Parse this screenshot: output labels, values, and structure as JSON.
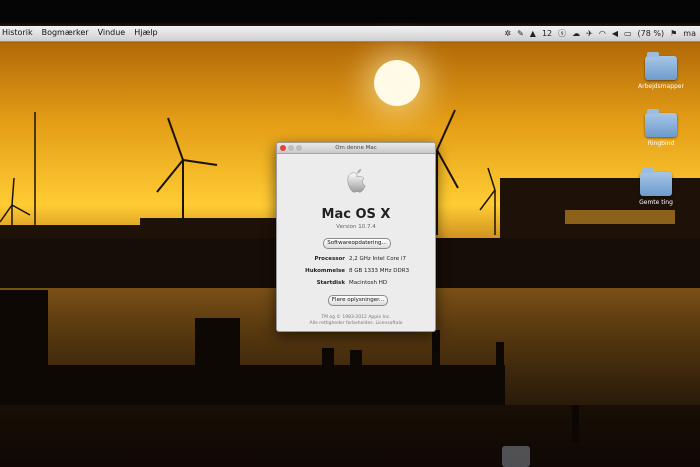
{
  "menubar": {
    "menus": [
      "Historik",
      "Bogmærker",
      "Vindue",
      "Hjælp"
    ],
    "status_items": [
      {
        "icon": "dropbox-icon",
        "text": ""
      },
      {
        "icon": "evernote-icon",
        "text": ""
      },
      {
        "icon": "airplay-icon",
        "text": "12"
      },
      {
        "icon": "skype-icon",
        "text": ""
      },
      {
        "icon": "cloud-icon",
        "text": ""
      },
      {
        "icon": "twitter-icon",
        "text": ""
      },
      {
        "icon": "wifi-icon",
        "text": ""
      },
      {
        "icon": "volume-icon",
        "text": ""
      },
      {
        "icon": "battery-icon",
        "text": "(78 %)"
      },
      {
        "icon": "flag-icon",
        "text": "ma"
      }
    ]
  },
  "desktop": {
    "icons": [
      {
        "label": "Arbejdsmapper"
      },
      {
        "label": "Ringbind"
      },
      {
        "label": "Gemte ting"
      }
    ]
  },
  "about_window": {
    "title": "Om denne Mac",
    "os_name": "Mac OS X",
    "version": "Version 10.7.4",
    "software_update_button": "Softwareopdatering...",
    "specs": [
      {
        "label": "Processor",
        "value": "2,2 GHz Intel Core i7"
      },
      {
        "label": "Hukommelse",
        "value": "8 GB 1333 MHz DDR3"
      },
      {
        "label": "Startdisk",
        "value": "Macintosh HD"
      }
    ],
    "more_info_button": "Flere oplysninger...",
    "legal_line1": "TM og © 1983-2012 Apple Inc.",
    "legal_line2": "Alle rettigheder forbeholdes. Licensaftale"
  },
  "colors": {
    "sky_top": "#b36a08",
    "sky_glow": "#ffcc33",
    "window_bg": "#ececec",
    "close_red": "#e0443e"
  }
}
